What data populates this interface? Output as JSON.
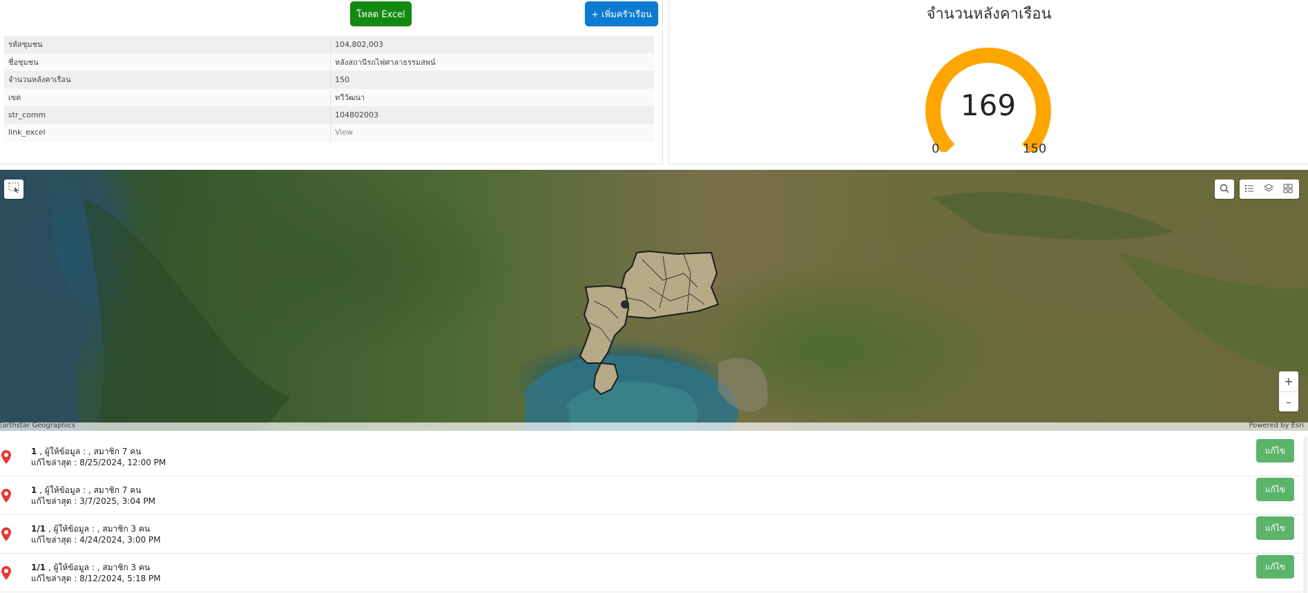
{
  "toolbar": {
    "excel_button": "โหลด Excel",
    "add_household_button": "+ เพิ่มครัวเรือน"
  },
  "info": {
    "rows": [
      {
        "key": "รหัสชุมชน",
        "value": "104,802,003"
      },
      {
        "key": "ชื่อชุมชน",
        "value": "หลังสถานีรถไฟศาลาธรรมสพน์"
      },
      {
        "key": "จำนวนหลังคาเรือน",
        "value": "150"
      },
      {
        "key": "เขต",
        "value": "ทวีวัฒนา"
      },
      {
        "key": "str_comm",
        "value": "104802003"
      },
      {
        "key": "link_excel",
        "value": "View"
      }
    ]
  },
  "gauge": {
    "title": "จำนวนหลังคาเรือน",
    "value": "169",
    "min": "0",
    "max": "150",
    "fill_fraction": 1.0,
    "color": "#ffa500"
  },
  "map": {
    "attribution_left": "Earthstar Geographics",
    "attribution_right": "Powered by Esri",
    "zoom_in": "+",
    "zoom_out": "–",
    "controls": [
      "select-icon",
      "search-icon",
      "list-icon",
      "layers-icon",
      "basemap-gallery-icon"
    ]
  },
  "list": {
    "items": [
      {
        "id": "1",
        "provider": " , ผู้ให้ข้อมูล : , สมาชิก 7  คน",
        "edited": "แก้ไขล่าสุด : 8/25/2024, 12:00 PM",
        "edit_label": "แก้ไข"
      },
      {
        "id": "1",
        "provider": " , ผู้ให้ข้อมูล : , สมาชิก 7  คน",
        "edited": "แก้ไขล่าสุด : 3/7/2025, 3:04 PM",
        "edit_label": "แก้ไข"
      },
      {
        "id": "1/1",
        "provider": " , ผู้ให้ข้อมูล : , สมาชิก 3  คน",
        "edited": "แก้ไขล่าสุด : 4/24/2024, 3:00 PM",
        "edit_label": "แก้ไข"
      },
      {
        "id": "1/1",
        "provider": " , ผู้ให้ข้อมูล : , สมาชิก 3  คน",
        "edited": "แก้ไขล่าสุด : 8/12/2024, 5:18 PM",
        "edit_label": "แก้ไข"
      }
    ]
  },
  "colors": {
    "excel_button": "#128a12",
    "add_button": "#0a7bd1",
    "edit_button": "#5cb46b",
    "pin": "#e53935"
  }
}
